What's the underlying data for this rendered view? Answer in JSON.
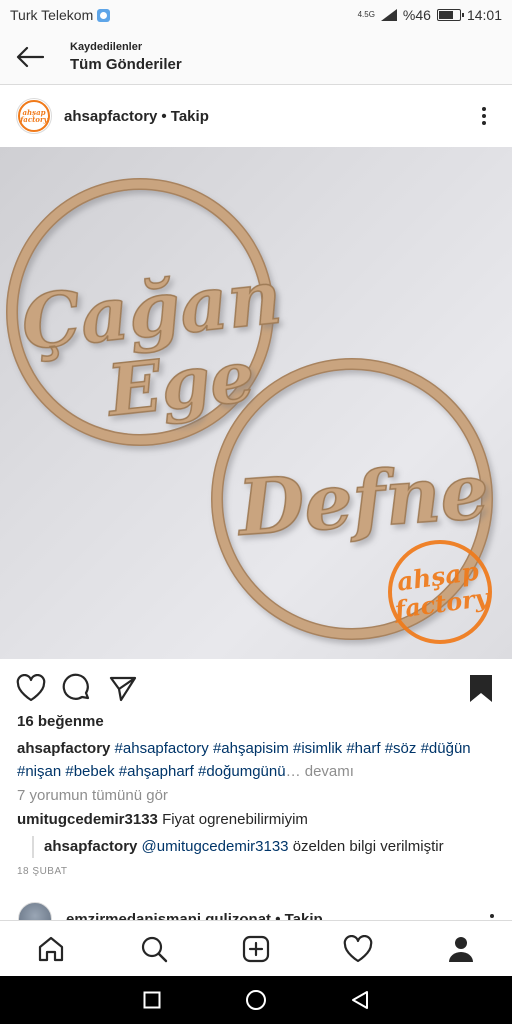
{
  "status_bar": {
    "carrier": "Turk Telekom",
    "network": "4.5G",
    "signal": "%46",
    "time": "14:01"
  },
  "header": {
    "subtitle": "Kaydedilenler",
    "title": "Tüm Gönderiler"
  },
  "post": {
    "username": "ahsapfactory",
    "follow_label": "• Takip",
    "avatar_text": "ahşap factory",
    "likes": "16 beğenme",
    "caption_user": "ahsapfactory",
    "hashtags": [
      "#ahsapfactory",
      "#ahşapisim",
      "#isimlik",
      "#harf",
      "#söz",
      "#düğün",
      "#nişan",
      "#bebek",
      "#ahşapharf",
      "#doğumgünü"
    ],
    "more_label": "… devamı",
    "view_comments": "7 yorumun tümünü gör",
    "comments": [
      {
        "user": "umitugcedemir3133",
        "text": "Fiyat ogrenebilirmiyim"
      }
    ],
    "reply": {
      "user": "ahsapfactory",
      "mention": "@umitugcedemir3133",
      "text": "özelden bilgi verilmiştir"
    },
    "date": "18 ŞUBAT",
    "image_texts": {
      "name1": "Çağan",
      "name2": "Ege",
      "name3": "Defne",
      "watermark_line1": "ahşap",
      "watermark_line2": "factory"
    }
  },
  "next_post": {
    "username": "emzirmedanismani.gulizonat",
    "follow_label": "• Takip"
  },
  "colors": {
    "wood": "#c9a47f",
    "wood_dark": "#a8835e",
    "brand_orange": "#f07a1a",
    "hashtag": "#003569",
    "muted": "#8e8e8e"
  },
  "icons": {
    "back": "arrow-left-icon",
    "more": "more-vertical-icon",
    "like": "heart-icon",
    "comment": "comment-icon",
    "share": "send-icon",
    "save": "bookmark-icon",
    "home": "home-icon",
    "search": "search-icon",
    "add": "add-post-icon",
    "activity": "heart-icon",
    "profile": "profile-icon"
  }
}
